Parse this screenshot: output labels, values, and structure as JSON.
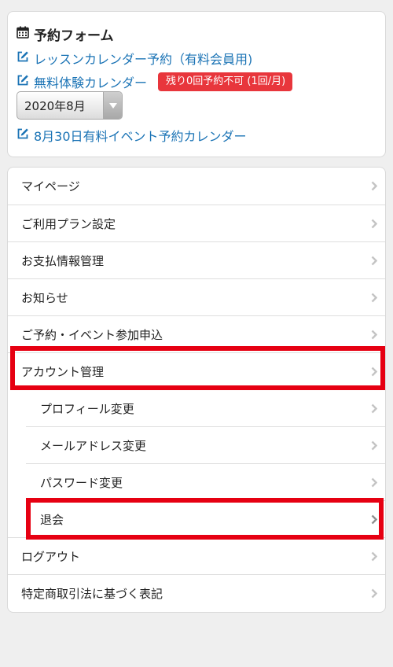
{
  "booking": {
    "title": "予約フォーム",
    "lesson_calendar_link": "レッスンカレンダー予約（有料会員用)",
    "trial_calendar_link": "無料体験カレンダー",
    "trial_badge": "残り0回予約不可 (1回/月)",
    "month_select_value": "2020年8月",
    "event_calendar_link": "8月30日有料イベント予約カレンダー"
  },
  "menu": {
    "items": [
      {
        "label": "マイページ"
      },
      {
        "label": "ご利用プラン設定"
      },
      {
        "label": "お支払情報管理"
      },
      {
        "label": "お知らせ"
      },
      {
        "label": "ご予約・イベント参加申込"
      },
      {
        "label": "アカウント管理"
      },
      {
        "label": "プロフィール変更"
      },
      {
        "label": "メールアドレス変更"
      },
      {
        "label": "パスワード変更"
      },
      {
        "label": "退会"
      },
      {
        "label": "ログアウト"
      },
      {
        "label": "特定商取引法に基づく表記"
      }
    ]
  },
  "colors": {
    "link": "#1a73b5",
    "badge": "#e8363c",
    "highlight": "#e60012",
    "background": "#efefef"
  },
  "icons": {
    "form_title": "calendar-icon",
    "links": "edit-icon",
    "menu": "chevron-right-icon",
    "select": "caret-down-icon"
  }
}
